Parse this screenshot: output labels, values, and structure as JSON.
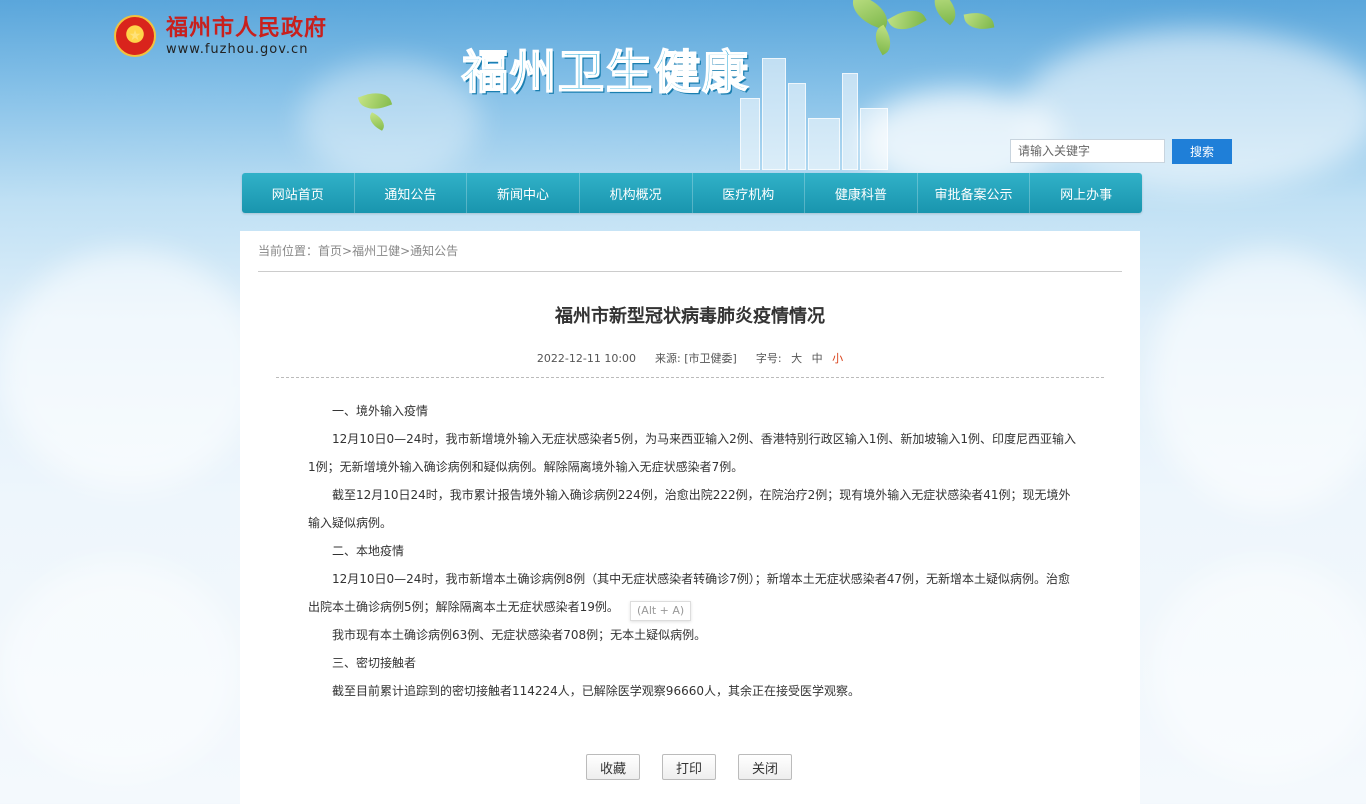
{
  "header": {
    "gov_name": "福州市人民政府",
    "gov_url": "www.fuzhou.gov.cn",
    "site_title": "福州卫生健康"
  },
  "search": {
    "placeholder": "请输入关键字",
    "button_label": "搜索"
  },
  "nav": {
    "items": [
      "网站首页",
      "通知公告",
      "新闻中心",
      "机构概况",
      "医疗机构",
      "健康科普",
      "审批备案公示",
      "网上办事"
    ]
  },
  "breadcrumb": {
    "prefix": "当前位置：",
    "path": "首页>福州卫健>通知公告"
  },
  "article": {
    "title": "福州市新型冠状病毒肺炎疫情情况",
    "date": "2022-12-11 10:00",
    "source": "来源: [市卫健委]",
    "font_size_label": "字号:",
    "font_sizes": [
      "大",
      "中",
      "小"
    ],
    "active_font_size": "小",
    "paragraphs": [
      "一、境外输入疫情",
      "12月10日0—24时，我市新增境外输入无症状感染者5例，为马来西亚输入2例、香港特别行政区输入1例、新加坡输入1例、印度尼西亚输入1例；无新增境外输入确诊病例和疑似病例。解除隔离境外输入无症状感染者7例。",
      "截至12月10日24时，我市累计报告境外输入确诊病例224例，治愈出院222例，在院治疗2例；现有境外输入无症状感染者41例；现无境外输入疑似病例。",
      "二、本地疫情",
      "12月10日0—24时，我市新增本土确诊病例8例（其中无症状感染者转确诊7例）；新增本土无症状感染者47例，无新增本土疑似病例。治愈出院本土确诊病例5例；解除隔离本土无症状感染者19例。",
      "我市现有本土确诊病例63例、无症状感染者708例；无本土疑似病例。",
      "三、密切接触者",
      "截至目前累计追踪到的密切接触者114224人，已解除医学观察96660人，其余正在接受医学观察。"
    ]
  },
  "tooltip": "(Alt + A)",
  "buttons": {
    "favorite": "收藏",
    "print": "打印",
    "close": "关闭"
  },
  "colors": {
    "nav_bg": "#1fa3bd",
    "search_button": "#1f7fd8",
    "gov_name": "#c8201d",
    "site_title": "#26a8d9",
    "active_font_size": "#d9411a"
  }
}
